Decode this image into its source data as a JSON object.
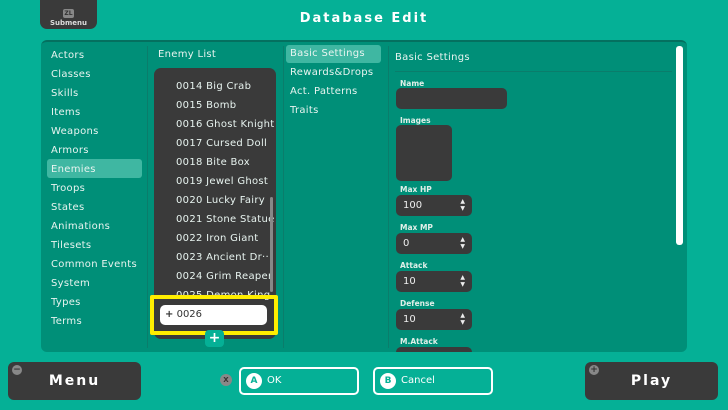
{
  "header": {
    "title": "Database Edit",
    "submenu_key": "ZL",
    "submenu_label": "Submenu"
  },
  "categories": [
    "Actors",
    "Classes",
    "Skills",
    "Items",
    "Weapons",
    "Armors",
    "Enemies",
    "Troops",
    "States",
    "Animations",
    "Tilesets",
    "Common Events",
    "System",
    "Types",
    "Terms"
  ],
  "selected_category": "Enemies",
  "enemy_list": {
    "title": "Enemy List",
    "items": [
      "0014 Big Crab",
      "0015 Bomb",
      "0016 Ghost Knight",
      "0017 Cursed Doll",
      "0018 Bite Box",
      "0019 Jewel Ghost",
      "0020 Lucky Fairy",
      "0021 Stone Statue",
      "0022 Iron Giant",
      "0023 Ancient Dr···",
      "0024 Grim Reaper",
      "0025 Demon King"
    ],
    "new_entry": "0026",
    "new_prefix": "+",
    "add_button": "+"
  },
  "tabs": [
    "Basic Settings",
    "Rewards&Drops",
    "Act. Patterns",
    "Traits"
  ],
  "selected_tab": "Basic Settings",
  "settings": {
    "title": "Basic Settings",
    "name_label": "Name",
    "name_value": "",
    "images_label": "Images",
    "fields": [
      {
        "label": "Max HP",
        "value": "100"
      },
      {
        "label": "Max MP",
        "value": "0"
      },
      {
        "label": "Attack",
        "value": "10"
      },
      {
        "label": "Defense",
        "value": "10"
      }
    ],
    "partial_label": "M.Attack"
  },
  "footer": {
    "menu": "Menu",
    "menu_key": "−",
    "play": "Play",
    "play_key": "+",
    "x_key": "X",
    "ok_key": "A",
    "ok": "OK",
    "cancel_key": "B",
    "cancel": "Cancel"
  },
  "colors": {
    "background": "#05b096",
    "panel": "#008f78",
    "dark": "#3a3a3a",
    "highlight": "#ffee00"
  }
}
